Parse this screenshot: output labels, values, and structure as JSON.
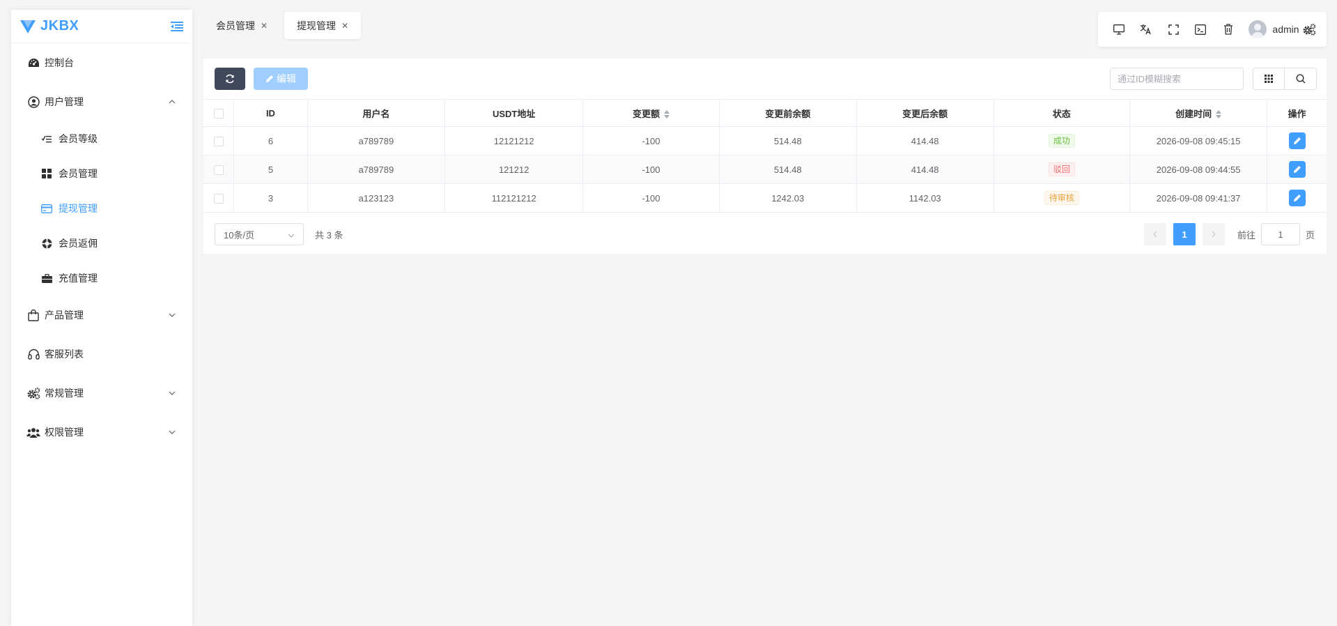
{
  "app": {
    "logo_text": "JKBX"
  },
  "sidebar": {
    "items": [
      {
        "label": "控制台",
        "icon": "dashboard-icon"
      },
      {
        "label": "用户管理",
        "icon": "user-circle-icon",
        "expanded": true,
        "children": [
          {
            "label": "会员等级",
            "icon": "list-check-icon"
          },
          {
            "label": "会员管理",
            "icon": "grid-icon"
          },
          {
            "label": "提现管理",
            "icon": "credit-card-icon",
            "active": true
          },
          {
            "label": "会员返佣",
            "icon": "lifebuoy-icon"
          },
          {
            "label": "充值管理",
            "icon": "briefcase-icon"
          }
        ]
      },
      {
        "label": "产品管理",
        "icon": "shopping-bag-icon"
      },
      {
        "label": "客服列表",
        "icon": "headset-icon"
      },
      {
        "label": "常规管理",
        "icon": "gears-icon"
      },
      {
        "label": "权限管理",
        "icon": "users-icon"
      }
    ]
  },
  "tabs": [
    {
      "label": "会员管理",
      "active": false
    },
    {
      "label": "提现管理",
      "active": true
    }
  ],
  "header": {
    "username": "admin"
  },
  "toolbar": {
    "edit_label": "编辑",
    "search_placeholder": "通过ID模糊搜索"
  },
  "table": {
    "columns": [
      "ID",
      "用户名",
      "USDT地址",
      "变更额",
      "变更前余额",
      "变更后余额",
      "状态",
      "创建时间",
      "操作"
    ],
    "rows": [
      {
        "id": "6",
        "username": "a789789",
        "usdt": "12121212",
        "change": "-100",
        "before": "514.48",
        "after": "414.48",
        "status": "成功",
        "status_type": "success",
        "created": "2026-09-08 09:45:15"
      },
      {
        "id": "5",
        "username": "a789789",
        "usdt": "121212",
        "change": "-100",
        "before": "514.48",
        "after": "414.48",
        "status": "驳回",
        "status_type": "danger",
        "created": "2026-09-08 09:44:55"
      },
      {
        "id": "3",
        "username": "a123123",
        "usdt": "112121212",
        "change": "-100",
        "before": "1242.03",
        "after": "1142.03",
        "status": "待审核",
        "status_type": "warning",
        "created": "2026-09-08 09:41:37"
      }
    ]
  },
  "pagination": {
    "page_size": "10条/页",
    "total": "共 3 条",
    "current": "1",
    "goto_label": "前往",
    "goto_value": "1",
    "page_suffix": "页"
  },
  "colors": {
    "primary": "#409eff",
    "dark_button": "#40485b",
    "success": "#67c23a",
    "danger": "#f56c6c",
    "warning": "#e6a23c"
  }
}
